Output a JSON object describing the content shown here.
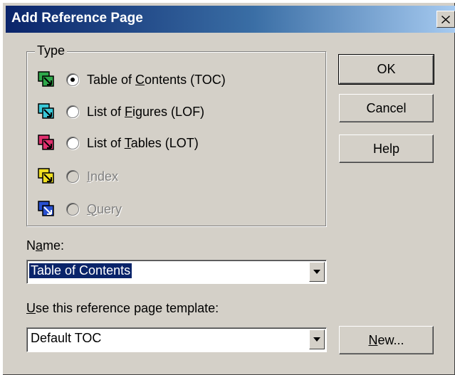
{
  "window": {
    "title": "Add Reference Page"
  },
  "type_group": {
    "label": "Type",
    "options": [
      {
        "pre": "Table of ",
        "key": "C",
        "post": "ontents (TOC)",
        "checked": true,
        "enabled": true,
        "icon": "toc-icon",
        "color": "#2ea84a"
      },
      {
        "pre": "List of ",
        "key": "F",
        "post": "igures (LOF)",
        "checked": false,
        "enabled": true,
        "icon": "lof-icon",
        "color": "#38c8d8"
      },
      {
        "pre": "List of ",
        "key": "T",
        "post": "ables (LOT)",
        "checked": false,
        "enabled": true,
        "icon": "lot-icon",
        "color": "#e0306e"
      },
      {
        "pre": "",
        "key": "I",
        "post": "ndex",
        "checked": false,
        "enabled": false,
        "icon": "index-icon",
        "color": "#f0e020"
      },
      {
        "pre": "",
        "key": "Q",
        "post": "uery",
        "checked": false,
        "enabled": false,
        "icon": "query-icon",
        "color": "#2850d0"
      }
    ]
  },
  "buttons": {
    "ok": "OK",
    "cancel": "Cancel",
    "help": "Help",
    "new_key": "N",
    "new_rest": "ew..."
  },
  "name_field": {
    "label_pre": "N",
    "label_key": "a",
    "label_post": "me:",
    "value": "Table of Contents"
  },
  "template_field": {
    "label_key": "U",
    "label_post": "se this reference page template:",
    "value": "Default TOC"
  },
  "colors": {
    "titlebar_start": "#0a246a",
    "titlebar_end": "#a6caf0",
    "face": "#d4d0c8",
    "selection": "#0a246a"
  }
}
